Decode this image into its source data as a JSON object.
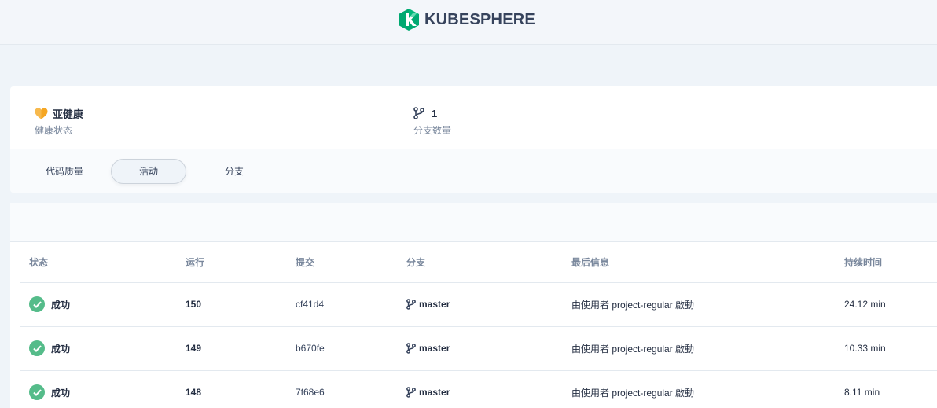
{
  "brand": {
    "name": "KUBESPHERE",
    "color": "#00a971"
  },
  "summary": {
    "health": {
      "value": "亚健康",
      "label": "健康状态",
      "icon": "heart-icon"
    },
    "branches": {
      "value": "1",
      "label": "分支数量",
      "icon": "branch-icon"
    }
  },
  "tabs": [
    {
      "label": "代码质量",
      "active": false
    },
    {
      "label": "活动",
      "active": true
    },
    {
      "label": "分支",
      "active": false
    }
  ],
  "table": {
    "headers": [
      "状态",
      "运行",
      "提交",
      "分支",
      "最后信息",
      "持续时间"
    ],
    "rows": [
      {
        "status": "成功",
        "run": "150",
        "commit": "cf41d4",
        "branch": "master",
        "message": "由使用者 project-regular 啟動",
        "duration": "24.12 min"
      },
      {
        "status": "成功",
        "run": "149",
        "commit": "b670fe",
        "branch": "master",
        "message": "由使用者 project-regular 啟動",
        "duration": "10.33 min"
      },
      {
        "status": "成功",
        "run": "148",
        "commit": "7f68e6",
        "branch": "master",
        "message": "由使用者 project-regular 啟動",
        "duration": "8.11 min"
      }
    ]
  }
}
